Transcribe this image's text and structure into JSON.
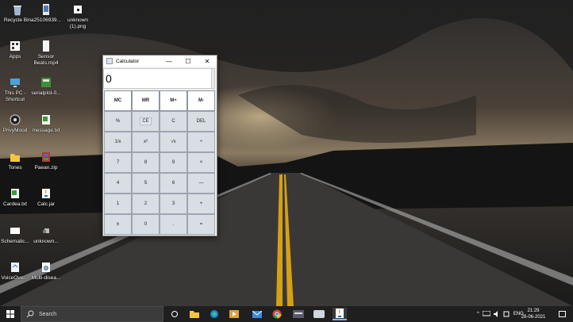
{
  "desktop": {
    "icons": [
      {
        "name": "recycle-bin-icon",
        "label": "Recycle Bin"
      },
      {
        "name": "image-file-icon",
        "label": "a25106939..."
      },
      {
        "name": "png-file-icon",
        "label": "unknown (1).png"
      },
      {
        "name": "apps-folder-icon",
        "label": "Apps"
      },
      {
        "name": "video-file-icon",
        "label": "Sensor Beats.mp4"
      },
      {
        "name": "this-pc-icon",
        "label": "This PC - Shortcut"
      },
      {
        "name": "serialplot-icon",
        "label": "serialplot-0..."
      },
      {
        "name": "privymood-icon",
        "label": "PrivyMood"
      },
      {
        "name": "text-file-icon",
        "label": "message.txt"
      },
      {
        "name": "tones-folder-icon",
        "label": "Tones"
      },
      {
        "name": "zip-file-icon",
        "label": "Paean.zip"
      },
      {
        "name": "text-file-icon",
        "label": "Cardea.txt"
      },
      {
        "name": "jar-file-icon",
        "label": "Calc.jar"
      },
      {
        "name": "schematic-file-icon",
        "label": "Schematic..."
      },
      {
        "name": "unknown-file-icon",
        "label": "unknown..."
      },
      {
        "name": "voiceover-file-icon",
        "label": "VoiceOver..."
      },
      {
        "name": "multi-disease-file-icon",
        "label": "Multi-disea..."
      }
    ]
  },
  "calculator": {
    "title": "Calculator",
    "controls": {
      "minimize": "—",
      "maximize": "☐",
      "close": "✕"
    },
    "display_value": "0",
    "keys": [
      {
        "label": "MC",
        "type": "mem"
      },
      {
        "label": "MR",
        "type": "mem"
      },
      {
        "label": "M+",
        "type": "mem"
      },
      {
        "label": "M-",
        "type": "mem"
      },
      {
        "label": "%",
        "type": "op"
      },
      {
        "label": "CE",
        "type": "ce"
      },
      {
        "label": "C",
        "type": "op"
      },
      {
        "label": "DEL",
        "type": "op"
      },
      {
        "label": "1/x",
        "type": "op"
      },
      {
        "label": "x²",
        "type": "op"
      },
      {
        "label": "√x",
        "type": "op"
      },
      {
        "label": "÷",
        "type": "op"
      },
      {
        "label": "7",
        "type": "num"
      },
      {
        "label": "8",
        "type": "num"
      },
      {
        "label": "9",
        "type": "num"
      },
      {
        "label": "×",
        "type": "op"
      },
      {
        "label": "4",
        "type": "num"
      },
      {
        "label": "5",
        "type": "num"
      },
      {
        "label": "6",
        "type": "num"
      },
      {
        "label": "—",
        "type": "op"
      },
      {
        "label": "1",
        "type": "num"
      },
      {
        "label": "2",
        "type": "num"
      },
      {
        "label": "3",
        "type": "num"
      },
      {
        "label": "+",
        "type": "op"
      },
      {
        "label": "±",
        "type": "op"
      },
      {
        "label": "0",
        "type": "num"
      },
      {
        "label": ".",
        "type": "op"
      },
      {
        "label": "=",
        "type": "op"
      }
    ]
  },
  "taskbar": {
    "search_placeholder": "Search",
    "apps": [
      {
        "name": "task-view-icon"
      },
      {
        "name": "file-explorer-icon"
      },
      {
        "name": "edge-icon"
      },
      {
        "name": "media-player-icon"
      },
      {
        "name": "mail-icon"
      },
      {
        "name": "chrome-icon"
      },
      {
        "name": "terminal-icon"
      },
      {
        "name": "device-app-icon"
      },
      {
        "name": "java-calculator-icon",
        "active": true
      }
    ],
    "tray": {
      "language": "ENG",
      "time": "21:29",
      "date": "28-06-2021"
    }
  }
}
